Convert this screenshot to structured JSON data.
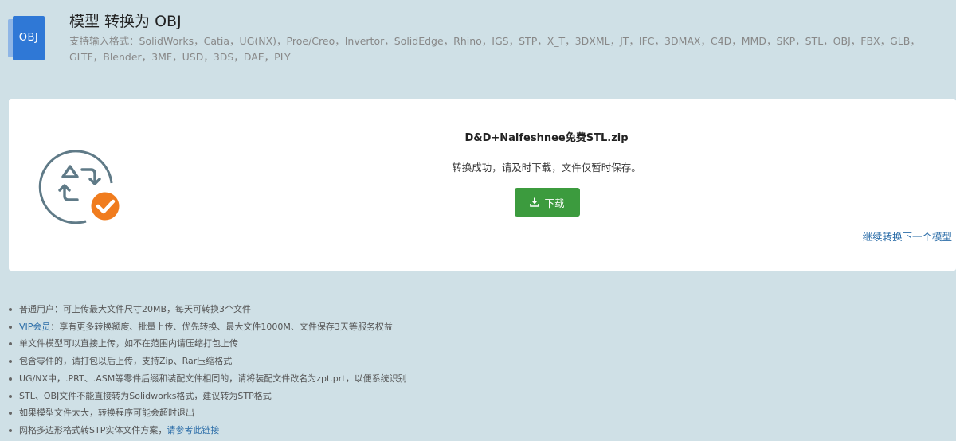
{
  "header": {
    "file_icon_label": "OBJ",
    "title": "模型 转换为 OBJ",
    "formats": "支持输入格式：SolidWorks，Catia，UG(NX)，Proe/Creo，Invertor，SolidEdge，Rhino，IGS，STP，X_T，3DXML，JT，IFC，3DMAX，C4D，MMD，SKP，STL，OBJ，FBX，GLB，GLTF，Blender，3MF，USD，3DS，DAE，PLY"
  },
  "result": {
    "filename": "D&D+Nalfeshnee免费STL.zip",
    "message": "转换成功，请及时下载，文件仅暂时保存。",
    "download_label": "下载",
    "continue_label": "继续转换下一个模型"
  },
  "notes": {
    "items": [
      {
        "text": "普通用户：可上传最大文件尺寸20MB，每天可转换3个文件"
      },
      {
        "link": "VIP会员",
        "text": "：享有更多转换额度、批量上传、优先转换、最大文件1000M、文件保存3天等服务权益"
      },
      {
        "text": "单文件模型可以直接上传，如不在范围内请压缩打包上传"
      },
      {
        "text": "包含零件的，请打包以后上传，支持Zip、Rar压缩格式"
      },
      {
        "text": "UG/NX中，.PRT、.ASM等零件后缀和装配文件相同的，请将装配文件改名为zpt.prt，以便系统识别"
      },
      {
        "text": "STL、OBJ文件不能直接转为Solidworks格式，建议转为STP格式"
      },
      {
        "text": "如果模型文件太大，转换程序可能会超时退出"
      },
      {
        "text": "网格多边形格式转STP实体文件方案，",
        "link": "请参考此链接"
      }
    ]
  },
  "colors": {
    "background": "#cfe0e6",
    "download_button": "#3c9b3e",
    "link": "#2b6da8",
    "check_badge": "#f07c1e",
    "file_icon": "#2f78d6"
  },
  "icons": {
    "file": "obj-file-icon",
    "convert": "convert-arrows-icon",
    "check": "check-circle-icon",
    "download": "download-icon"
  }
}
